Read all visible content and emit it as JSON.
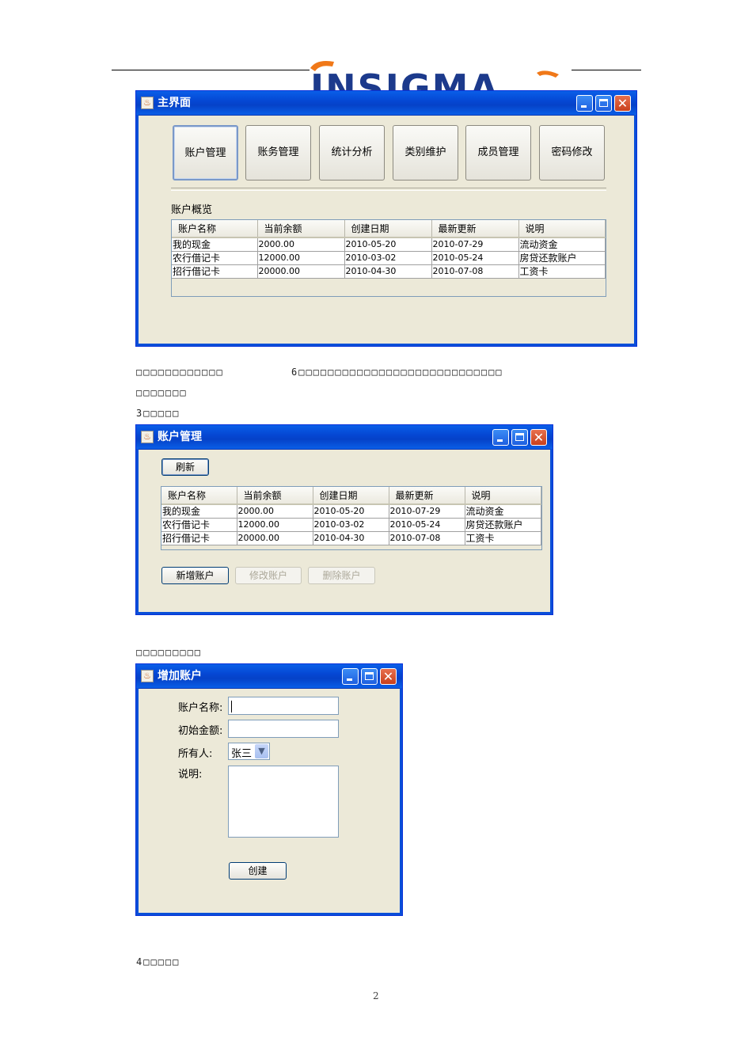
{
  "header": {
    "logo_text": "INSIGMA"
  },
  "main_window": {
    "title": "主界面",
    "buttons": [
      "账户管理",
      "账务管理",
      "统计分析",
      "类别维护",
      "成员管理",
      "密码修改"
    ],
    "overview_label": "账户概览",
    "table": {
      "headers": [
        "账户名称",
        "当前余额",
        "创建日期",
        "最新更新",
        "说明"
      ],
      "rows": [
        [
          "我的现金",
          "2000.00",
          "2010-05-20",
          "2010-07-29",
          "流动资金"
        ],
        [
          "农行借记卡",
          "12000.00",
          "2010-03-02",
          "2010-05-24",
          "房贷还款账户"
        ],
        [
          "招行借记卡",
          "20000.00",
          "2010-04-30",
          "2010-07-08",
          "工资卡"
        ]
      ]
    }
  },
  "doc_text": {
    "line1_a": "□□□□□□□□□□□□",
    "line1_b": "6□□□□□□□□□□□□□□□□□□□□□□□□□□□□",
    "line2": "□□□□□□□",
    "line3": "3□□□□□",
    "line4": "□□□□□□□□□",
    "line5": "4□□□□□"
  },
  "account_window": {
    "title": "账户管理",
    "refresh_label": "刷新",
    "table": {
      "headers": [
        "账户名称",
        "当前余额",
        "创建日期",
        "最新更新",
        "说明"
      ],
      "rows": [
        [
          "我的现金",
          "2000.00",
          "2010-05-20",
          "2010-07-29",
          "流动资金"
        ],
        [
          "农行借记卡",
          "12000.00",
          "2010-03-02",
          "2010-05-24",
          "房贷还款账户"
        ],
        [
          "招行借记卡",
          "20000.00",
          "2010-04-30",
          "2010-07-08",
          "工资卡"
        ]
      ]
    },
    "add_label": "新增账户",
    "edit_label": "修改账户",
    "delete_label": "删除账户"
  },
  "add_window": {
    "title": "增加账户",
    "name_label": "账户名称:",
    "amount_label": "初始金额:",
    "owner_label": "所有人:",
    "owner_value": "张三",
    "desc_label": "说明:",
    "create_label": "创建"
  },
  "page_number": "2"
}
